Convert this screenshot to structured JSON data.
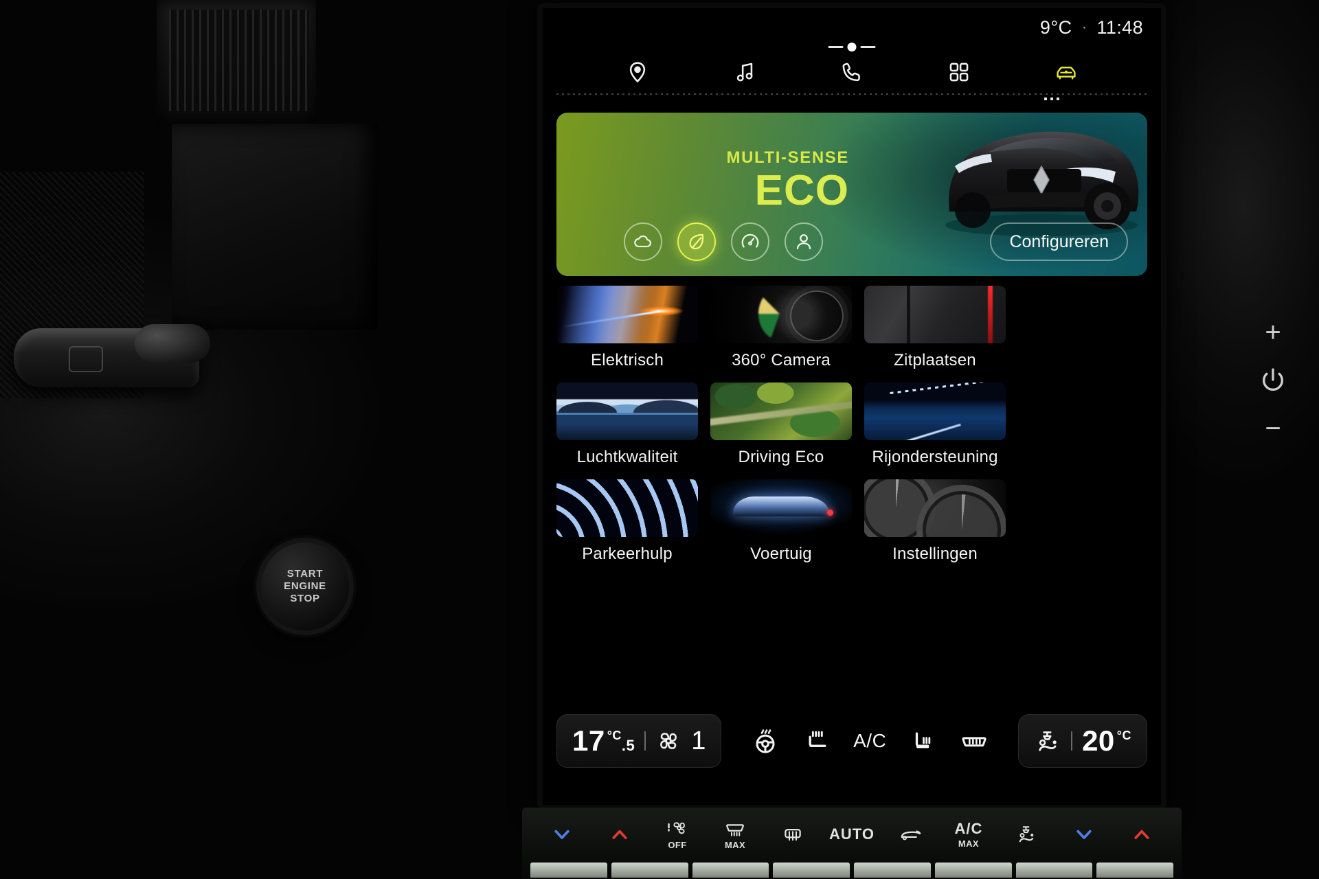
{
  "status": {
    "temperature": "9°C",
    "separator": "·",
    "time": "11:48"
  },
  "tabs": [
    {
      "name": "navigation",
      "icon": "map-pin-icon",
      "active": false
    },
    {
      "name": "media",
      "icon": "music-note-icon",
      "active": false
    },
    {
      "name": "phone",
      "icon": "phone-icon",
      "active": false
    },
    {
      "name": "apps",
      "icon": "grid-apps-icon",
      "active": false
    },
    {
      "name": "vehicle",
      "icon": "car-icon",
      "active": true
    }
  ],
  "hero": {
    "kicker": "MULTI-SENSE",
    "title": "ECO",
    "configure_label": "Configureren",
    "modes": [
      {
        "label": "Comfort",
        "icon": "cloud-icon",
        "selected": false
      },
      {
        "label": "Eco",
        "icon": "leaf-icon",
        "selected": true
      },
      {
        "label": "Sport",
        "icon": "gauge-icon",
        "selected": false
      },
      {
        "label": "Perso",
        "icon": "person-icon",
        "selected": false
      }
    ],
    "accent_color": "#dced4e"
  },
  "tiles": [
    {
      "label": "Elektrisch",
      "art": "th-elektrisch"
    },
    {
      "label": "360° Camera",
      "art": "th-camera"
    },
    {
      "label": "Zitplaatsen",
      "art": "th-zit"
    },
    {
      "label": "Luchtkwaliteit",
      "art": "th-lucht"
    },
    {
      "label": "Driving Eco",
      "art": "th-driveco"
    },
    {
      "label": "Rijondersteuning",
      "art": "th-rij"
    },
    {
      "label": "Parkeerhulp",
      "art": "th-park"
    },
    {
      "label": "Voertuig",
      "art": "th-voertuig"
    },
    {
      "label": "Instellingen",
      "art": "th-inst"
    }
  ],
  "climate": {
    "left_temp_whole": "17",
    "left_temp_dec": ".5",
    "left_unit": "°C",
    "fan_speed": "1",
    "right_temp": "20",
    "right_unit": "°C",
    "ac_label": "A/C",
    "icons": [
      {
        "name": "heated-steering-wheel-icon"
      },
      {
        "name": "heated-seat-left-icon"
      },
      {
        "name": "ac-label"
      },
      {
        "name": "heated-seat-right-icon"
      },
      {
        "name": "rear-defrost-icon"
      }
    ]
  },
  "hardkeys": [
    {
      "name": "temp-down",
      "icon": "chevron-down-icon",
      "color": "blue",
      "label": ""
    },
    {
      "name": "temp-up",
      "icon": "chevron-up-icon",
      "color": "red",
      "label": ""
    },
    {
      "name": "fan-off",
      "icon": "fan-icon",
      "color": "white",
      "label": "OFF"
    },
    {
      "name": "front-defrost-max",
      "icon": "defrost-front-icon",
      "color": "white",
      "label": "MAX"
    },
    {
      "name": "rear-defrost",
      "icon": "defrost-rear-icon",
      "color": "white",
      "label": ""
    },
    {
      "name": "auto",
      "icon": "",
      "color": "white",
      "label": "AUTO"
    },
    {
      "name": "recirculation",
      "icon": "recirculation-icon",
      "color": "white",
      "label": ""
    },
    {
      "name": "ac-max",
      "icon": "",
      "color": "white",
      "label": "A/C"
    },
    {
      "name": "airflow-mode",
      "icon": "airflow-icon",
      "color": "white",
      "label": ""
    },
    {
      "name": "passenger-temp-down",
      "icon": "chevron-down-icon",
      "color": "blue",
      "label": ""
    },
    {
      "name": "passenger-temp-up",
      "icon": "chevron-up-icon",
      "color": "red",
      "label": ""
    }
  ],
  "hardkey_sub": {
    "ac_max": "MAX"
  },
  "start_button": {
    "line1": "START",
    "line2": "ENGINE",
    "line3": "STOP"
  },
  "side_controls": {
    "plus": "+",
    "minus": "−",
    "power": "power-icon"
  }
}
